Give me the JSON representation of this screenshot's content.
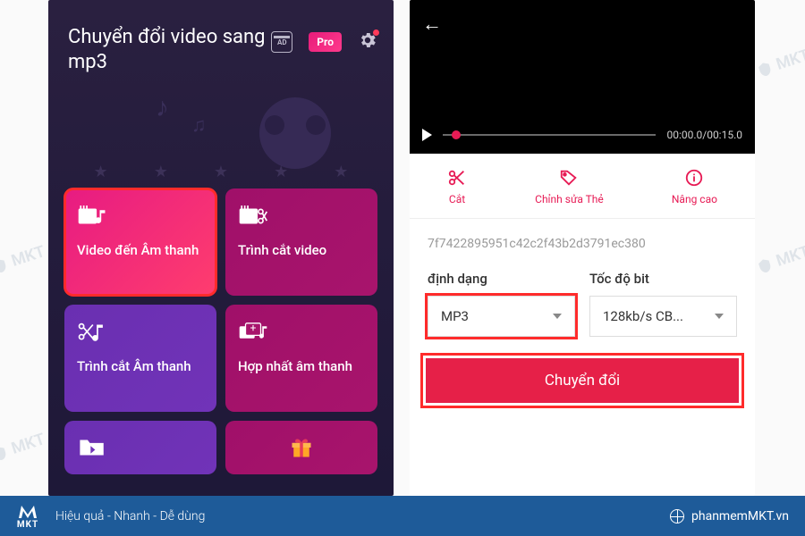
{
  "left": {
    "title": "Chuyển đổi video sang mp3",
    "pro_label": "Pro",
    "ad_label": "AD",
    "tiles": [
      {
        "label": "Video đến Âm thanh"
      },
      {
        "label": "Trình cắt video"
      },
      {
        "label": "Trình cắt Âm thanh"
      },
      {
        "label": "Hợp nhất âm thanh"
      },
      {
        "label": ""
      },
      {
        "label": ""
      }
    ]
  },
  "right": {
    "time": "00:00.0/00:15.0",
    "tools": {
      "cut": "Cắt",
      "edit_tag": "Chỉnh sửa Thẻ",
      "advanced": "Nâng cao"
    },
    "filename": "7f7422895951c42c2f43b2d3791ec380",
    "format_label": "định dạng",
    "format_value": "MP3",
    "bitrate_label": "Tốc độ bit",
    "bitrate_value": "128kb/s CB...",
    "convert_label": "Chuyển đổi"
  },
  "footer": {
    "logo": "MKT",
    "slogan": "Hiệu quả - Nhanh - Dễ dùng",
    "url": "phanmemMKT.vn"
  },
  "watermark": "MKT"
}
